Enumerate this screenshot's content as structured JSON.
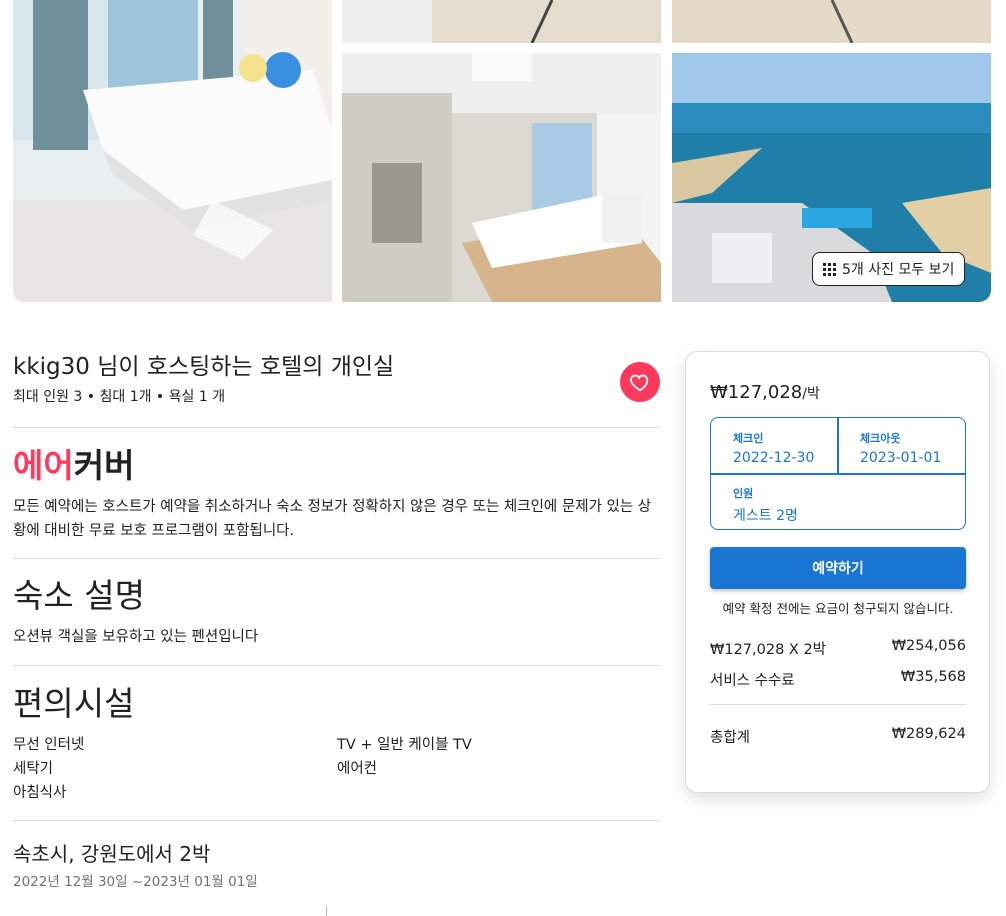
{
  "gallery": {
    "show_all_label": "5개 사진 모두 보기"
  },
  "listing": {
    "title": "kkig30 님이 호스팅하는 호텔의 개인실",
    "subtitle": "최대 인원 3 • 침대 1개 • 욕실 1 개"
  },
  "aircover": {
    "title_red": "에어",
    "title_rest": "커버",
    "description": "모든 예약에는 호스트가 예약을 취소하거나 숙소 정보가 정확하지 않은 경우 또는 체크인에 문제가 있는 상황에 대비한 무료 보호 프로그램이 포함됩니다."
  },
  "description_section": {
    "heading": "숙소 설명",
    "text": "오션뷰 객실을 보유하고 있는 펜션입니다"
  },
  "amenities": {
    "heading": "편의시설",
    "items": [
      "무선 인터넷",
      "TV + 일반 케이블 TV",
      "세탁기",
      "에어컨",
      "아침식사"
    ]
  },
  "trip": {
    "title": "속초시, 강원도에서 2박",
    "dates": "2022년 12월 30일 ~2023년 01월 01일"
  },
  "booking": {
    "price": "₩127,028",
    "price_unit": "/박",
    "checkin_label": "체크인",
    "checkin_value": "2022-12-30",
    "checkout_label": "체크아웃",
    "checkout_value": "2023-01-01",
    "guests_label": "인원",
    "guests_value": "게스트 2명",
    "reserve_label": "예약하기",
    "note": "예약 확정 전에는 요금이 청구되지 않습니다.",
    "nights_label": "₩127,028 X 2박",
    "nights_value": "₩254,056",
    "fee_label": "서비스 수수료",
    "fee_value": "₩35,568",
    "total_label": "총합계",
    "total_value": "₩289,624"
  },
  "colors": {
    "brand": "#ff385c",
    "accent": "#1976d2"
  }
}
